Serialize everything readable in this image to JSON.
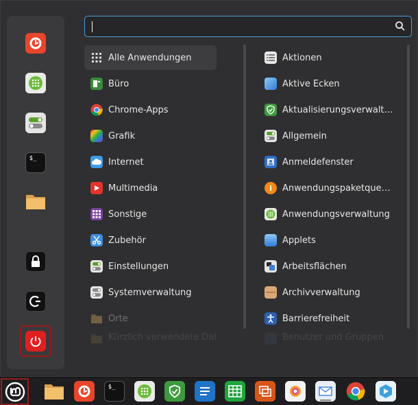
{
  "search": {
    "value": "",
    "placeholder": ""
  },
  "favorites": [
    {
      "name": "firefox",
      "icon": "firefox-icon"
    },
    {
      "name": "software-manager",
      "icon": "software-manager-icon"
    },
    {
      "name": "settings",
      "icon": "toggles-icon"
    },
    {
      "name": "terminal",
      "icon": "terminal-icon"
    },
    {
      "name": "files",
      "icon": "folder-icon"
    },
    {
      "name": "lock",
      "icon": "lock-icon"
    },
    {
      "name": "logout",
      "icon": "logout-icon"
    },
    {
      "name": "shutdown",
      "icon": "power-icon"
    }
  ],
  "categories": [
    {
      "label": "Alle Anwendungen",
      "icon": "grid-icon"
    },
    {
      "label": "Büro",
      "icon": "office-icon"
    },
    {
      "label": "Chrome-Apps",
      "icon": "chrome-icon"
    },
    {
      "label": "Grafik",
      "icon": "graphics-icon"
    },
    {
      "label": "Internet",
      "icon": "cloud-icon"
    },
    {
      "label": "Multimedia",
      "icon": "play-icon"
    },
    {
      "label": "Sonstige",
      "icon": "other-icon"
    },
    {
      "label": "Zubehör",
      "icon": "scissors-icon"
    },
    {
      "label": "Einstellungen",
      "icon": "toggles-icon"
    },
    {
      "label": "Systemverwaltung",
      "icon": "toggles-icon"
    },
    {
      "label": "Orte",
      "icon": "folder-icon"
    },
    {
      "label": "Kürzlich verwendete Dateien",
      "icon": "folder-icon"
    }
  ],
  "apps": [
    {
      "label": "Aktionen",
      "icon": "list-icon"
    },
    {
      "label": "Aktive Ecken",
      "icon": "corner-icon"
    },
    {
      "label": "Aktualisierungsverwalt…",
      "icon": "shield-icon"
    },
    {
      "label": "Allgemein",
      "icon": "toggles-icon"
    },
    {
      "label": "Anmeldefenster",
      "icon": "login-icon"
    },
    {
      "label": "Anwendungspaketque…",
      "icon": "info-icon"
    },
    {
      "label": "Anwendungsverwaltung",
      "icon": "software-manager-icon"
    },
    {
      "label": "Applets",
      "icon": "applet-icon"
    },
    {
      "label": "Arbeitsflächen",
      "icon": "workspace-icon"
    },
    {
      "label": "Archivverwaltung",
      "icon": "archive-icon"
    },
    {
      "label": "Barrierefreiheit",
      "icon": "accessibility-icon"
    },
    {
      "label": "Benutzer und Gruppen",
      "icon": "users-icon"
    }
  ],
  "taskbar": [
    "files-icon",
    "firefox-icon",
    "terminal-icon",
    "software-manager-icon",
    "update-manager-icon",
    "text-editor-icon",
    "spreadsheet-icon",
    "impress-icon",
    "photo-icon",
    "mail-icon",
    "chrome-icon",
    "warpinator-icon"
  ],
  "colors": {
    "accent": "#4c9bd8",
    "selection_border": "#9a1a1a",
    "power": "#e02020"
  }
}
